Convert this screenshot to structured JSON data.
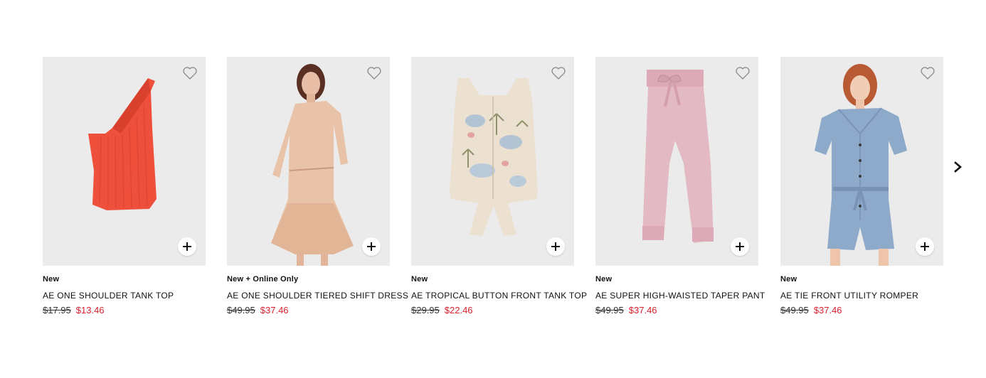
{
  "products": [
    {
      "flag": "New",
      "name": "AE ONE SHOULDER TANK TOP",
      "price_original": "$17.95",
      "price_sale": "$13.46",
      "color": "#f0523e"
    },
    {
      "flag": "New + Online Only",
      "name": "AE ONE SHOULDER TIERED SHIFT DRESS",
      "price_original": "$49.95",
      "price_sale": "$37.46",
      "color": "#e6c2a8"
    },
    {
      "flag": "New",
      "name": "AE TROPICAL BUTTON FRONT TANK TOP",
      "price_original": "$29.95",
      "price_sale": "$22.46",
      "color": "#eadfcf"
    },
    {
      "flag": "New",
      "name": "AE SUPER HIGH-WAISTED TAPER PANT",
      "price_original": "$49.95",
      "price_sale": "$37.46",
      "color": "#e3b9c2"
    },
    {
      "flag": "New",
      "name": "AE TIE FRONT UTILITY ROMPER",
      "price_original": "$49.95",
      "price_sale": "$37.46",
      "color": "#8ea9c9"
    }
  ],
  "icons": {
    "wishlist": "heart-outline-icon",
    "quick_add": "plus-icon",
    "next": "chevron-right-icon"
  },
  "colors": {
    "sale_price": "#d9232e",
    "image_background": "#ebebeb"
  }
}
